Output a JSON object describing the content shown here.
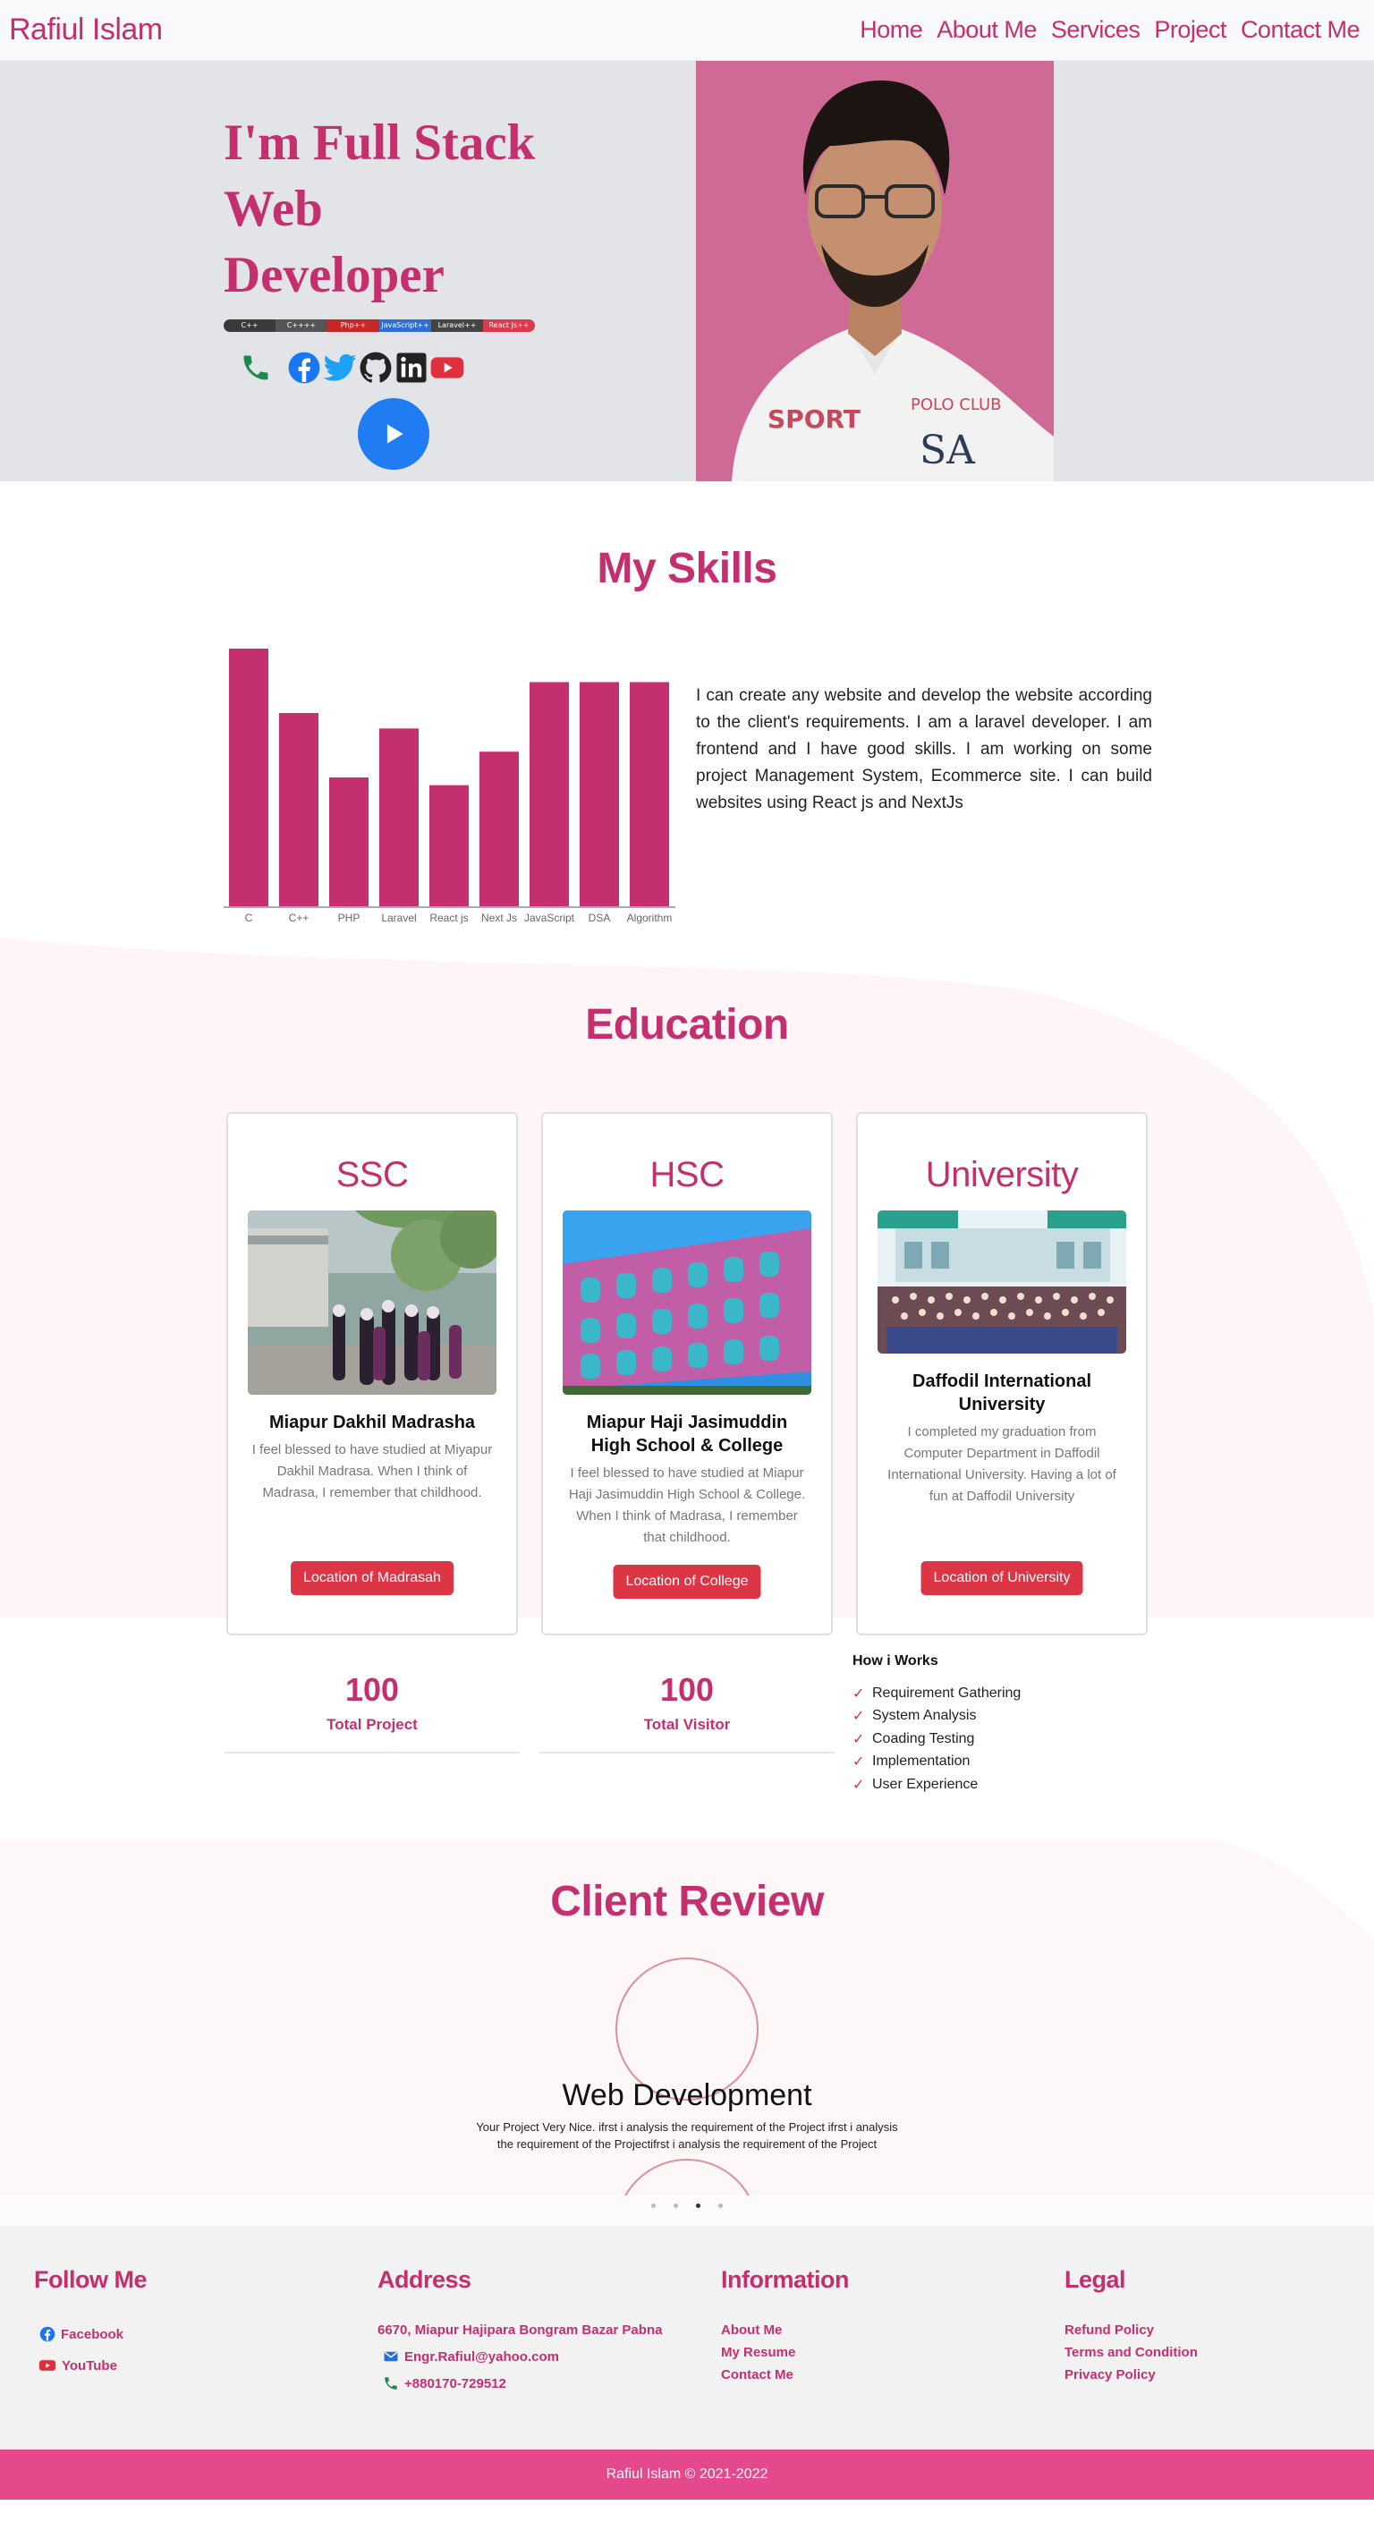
{
  "nav": {
    "brand": "Rafiul Islam",
    "links": [
      "Home",
      "About Me",
      "Services",
      "Project",
      "Contact Me"
    ]
  },
  "hero": {
    "title_line1": "I'm Full Stack",
    "title_line2": "Web Developer",
    "skill_badges": [
      {
        "label": "C++",
        "color": "#3a3a3a"
      },
      {
        "label": "C++++",
        "color": "#555555"
      },
      {
        "label": "Php++",
        "color": "#c62828"
      },
      {
        "label": "JavaScript++",
        "color": "#2f6fd0"
      },
      {
        "label": "Laravel++",
        "color": "#444444"
      },
      {
        "label": "React Js++",
        "color": "#d93b4c"
      }
    ],
    "social_icons": [
      "phone-icon",
      "facebook-icon",
      "twitter-icon",
      "github-icon",
      "linkedin-icon",
      "youtube-icon"
    ]
  },
  "skills": {
    "title": "My Skills",
    "description": "I can create any website and develop the website according to the client's requirements. I am a laravel developer. I am frontend and I have good skills. I am working on some project Management System, Ecommerce site. I can build websites using React js and NextJs"
  },
  "chart_data": {
    "type": "bar",
    "categories": [
      "C",
      "C++",
      "PHP",
      "Laravel",
      "React js",
      "Next Js",
      "JavaScript",
      "DSA",
      "Algorithm"
    ],
    "values": [
      100,
      75,
      50,
      69,
      47,
      60,
      87,
      87,
      87
    ],
    "ylim": [
      0,
      100
    ],
    "grid": false,
    "color": "#c4306f"
  },
  "education": {
    "title": "Education",
    "cards": [
      {
        "head": "SSC",
        "name": "Miapur Dakhil Madrasha",
        "desc": "I feel blessed to have studied at Miyapur Dakhil Madrasa. When I think of Madrasa, I remember that childhood.",
        "button": "Location of Madrasah"
      },
      {
        "head": "HSC",
        "name": "Miapur Haji Jasimuddin High School & College",
        "desc": "I feel blessed to have studied at Miapur Haji Jasimuddin High School & College. When I think of Madrasa, I remember that childhood.",
        "button": "Location of College"
      },
      {
        "head": "University",
        "name": "Daffodil International University",
        "desc": "I completed my graduation from Computer Department in Daffodil International University. Having a lot of fun at Daffodil University",
        "button": "Location of University"
      }
    ]
  },
  "stats": [
    {
      "value": "100",
      "label": "Total Project"
    },
    {
      "value": "100",
      "label": "Total Visitor"
    }
  ],
  "how": {
    "title": "How i Works",
    "items": [
      "Requirement Gathering",
      "System Analysis",
      "Coading Testing",
      "Implementation",
      "User Experience"
    ]
  },
  "review": {
    "title": "Client Review",
    "heading": "Web Development",
    "text": "Your Project Very Nice. ifrst i analysis the requirement of the Project ifrst i analysis the requirement of the Projectifrst i analysis the requirement of the Project",
    "dots": 4,
    "active_dot": 3
  },
  "footer": {
    "follow": {
      "title": "Follow Me",
      "links": [
        "Facebook",
        "YouTube"
      ]
    },
    "address": {
      "title": "Address",
      "street": "6670, Miapur Hajipara Bongram Bazar Pabna",
      "email": "Engr.Rafiul@yahoo.com",
      "phone": "+880170-729512"
    },
    "information": {
      "title": "Information",
      "links": [
        "About Me",
        "My Resume",
        "Contact Me"
      ]
    },
    "legal": {
      "title": "Legal",
      "links": [
        "Refund Policy",
        "Terms and Condition",
        "Privacy Policy"
      ]
    },
    "copyright": "Rafiul Islam © 2021-2022"
  },
  "colors": {
    "accent": "#c4306f",
    "photo_bg": "#cf6a97",
    "button_red": "#dc3545",
    "footer_bar": "#e4498c",
    "play_blue": "#1f7cf2"
  }
}
